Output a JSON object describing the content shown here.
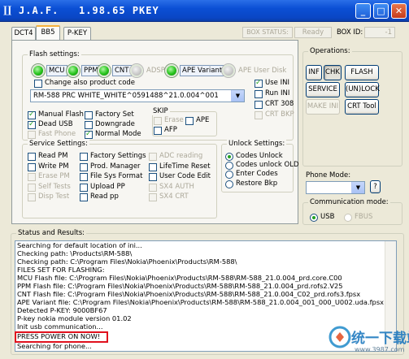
{
  "window": {
    "title": "J.A.F.   1.98.65 PKEY",
    "app_icon": "J-glyph",
    "buttons": [
      "minimize",
      "maximize",
      "close"
    ]
  },
  "tabs": [
    {
      "label": "DCT4"
    },
    {
      "label": "BB5",
      "active": true
    },
    {
      "label": "P-KEY"
    }
  ],
  "top_status": {
    "box_status_label": "BOX STATUS:",
    "box_status_value": "Ready",
    "box_id_label": "BOX ID:",
    "box_id_value": "-1"
  },
  "flash_settings": {
    "title": "Flash settings:",
    "leds": [
      {
        "label": "MCU",
        "on": true
      },
      {
        "label": "PPM",
        "on": true
      },
      {
        "label": "CNT",
        "on": true
      },
      {
        "label": "ADSP",
        "on": false
      },
      {
        "label": "APE Variant",
        "on": true
      },
      {
        "label": "APE User Disk",
        "on": false
      }
    ],
    "change_product_code": "Change also product code",
    "product_combo": "RM-588 PRC WHITE_WHITE^0591488^21.0.004^001",
    "use_ini": "Use INI",
    "run_ini": "Run INI",
    "crt308": "CRT 308",
    "crt_bkp": "CRT BKP",
    "manual_flash": "Manual Flash",
    "dead_usb": "Dead USB",
    "fast_phone": "Fast Phone",
    "factory_set": "Factory Set",
    "downgrade": "Downgrade",
    "normal_mode": "Normal Mode",
    "skip": {
      "title": "SKIP",
      "erase": "Erase",
      "ape": "APE",
      "afp": "AFP"
    }
  },
  "service_settings": {
    "title": "Service Settings:",
    "col1": [
      "Read PM",
      "Write PM",
      "Erase PM",
      "Self Tests",
      "Disp Test"
    ],
    "col2": [
      "Factory Settings",
      "Prod. Manager",
      "File Sys Format",
      "Upload PP",
      "Read pp"
    ],
    "col3": [
      "ADC reading",
      "LifeTime Reset",
      "User Code Edit",
      "SX4 AUTH",
      "SX4 CRT"
    ]
  },
  "unlock_settings": {
    "title": "Unlock Settings:",
    "options": [
      "Codes Unlock",
      "Codes unlock OLD",
      "Enter Codes",
      "Restore Bkp"
    ],
    "selected": 0
  },
  "operations": {
    "title": "Operations:",
    "buttons": [
      "INF",
      "CHK",
      "FLASH",
      "SERVICE",
      "(UN)LOCK",
      "MAKE INI",
      "CRT Tool"
    ]
  },
  "phone_mode": {
    "label": "Phone Mode:",
    "value": "",
    "help": "?"
  },
  "comm_mode": {
    "title": "Communication mode:",
    "options": [
      "USB",
      "FBUS"
    ],
    "selected": "USB"
  },
  "status": {
    "title": "Status and Results:",
    "lines": [
      "Searching for default location of ini...",
      "Checking path: \\Products\\RM-588\\",
      "Checking path: C:\\Program Files\\Nokia\\Phoenix\\Products\\RM-588\\",
      "FILES SET FOR FLASHING:",
      "MCU Flash file: C:\\Program Files\\Nokia\\Phoenix\\Products\\RM-588\\RM-588_21.0.004_prd.core.C00",
      "PPM Flash file: C:\\Program Files\\Nokia\\Phoenix\\Products\\RM-588\\RM-588_21.0.004_prd.rofs2.V25",
      "CNT Flash file: C:\\Program Files\\Nokia\\Phoenix\\Products\\RM-588\\RM-588_21.0.004_C02_prd.rofs3.fpsx",
      "APE Variant file: C:\\Program Files\\Nokia\\Phoenix\\Products\\RM-588\\RM-588_21.0.004_001_000_U002.uda.fpsx",
      "Detected P-KEY: 9000BF67",
      "P-key nokia module version 01.02",
      "Init usb communication...",
      "PRESS POWER ON NOW!",
      "Searching for phone..."
    ]
  },
  "watermark": {
    "text": "统一下载站",
    "url": "www.3987.com"
  }
}
